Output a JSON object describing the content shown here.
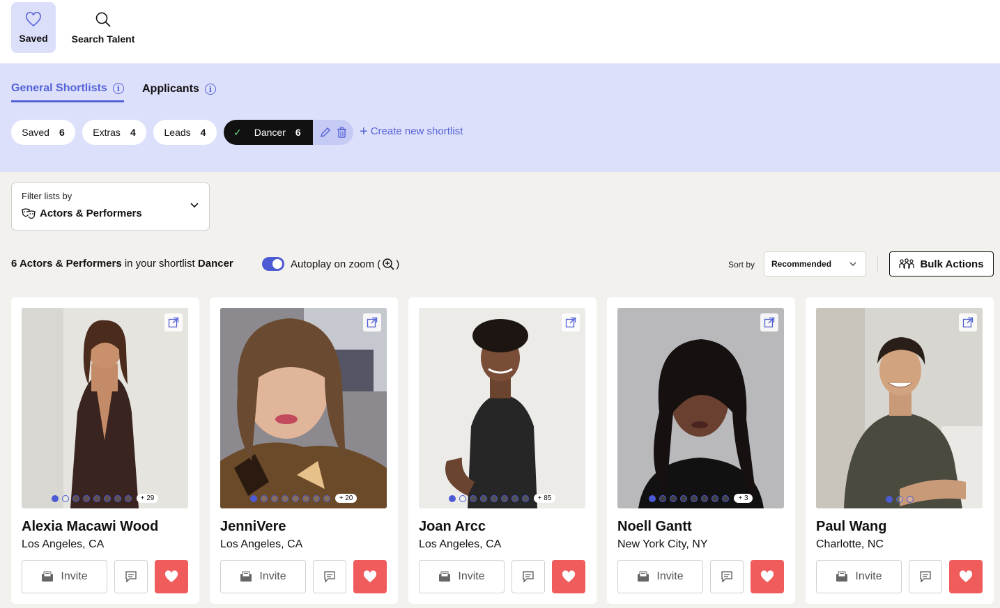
{
  "topnav": {
    "items": [
      {
        "label": "Saved",
        "icon": "heart-outline-icon",
        "active": true
      },
      {
        "label": "Search Talent",
        "icon": "search-icon",
        "active": false
      }
    ]
  },
  "tabs": [
    {
      "label": "General Shortlists",
      "active": true
    },
    {
      "label": "Applicants",
      "active": false
    }
  ],
  "shortlists": [
    {
      "label": "Saved",
      "count": "6"
    },
    {
      "label": "Extras",
      "count": "4"
    },
    {
      "label": "Leads",
      "count": "4"
    },
    {
      "label": "Dancer",
      "count": "6",
      "selected": true
    }
  ],
  "create_label": "Create new shortlist",
  "filter": {
    "label": "Filter lists by",
    "value": "Actors & Performers"
  },
  "summary": {
    "count_label": "6 Actors & Performers",
    "middle": "in your shortlist",
    "list_name": "Dancer",
    "autoplay_label": "Autoplay on zoom (",
    "autoplay_close": ")",
    "autoplay_on": true
  },
  "sort": {
    "label": "Sort by",
    "value": "Recommended"
  },
  "bulk_label": "Bulk Actions",
  "colors": {
    "accent": "#4c5bd4",
    "band": "#dde0fb",
    "heart": "#f05c5c"
  },
  "cards": [
    {
      "name": "Alexia Macawi Wood",
      "location": "Los Angeles, CA",
      "more": "+ 29",
      "dots": 8,
      "invite": "Invite"
    },
    {
      "name": "JenniVere",
      "location": "Los Angeles, CA",
      "more": "+ 20",
      "dots": 8,
      "invite": "Invite"
    },
    {
      "name": "Joan Arcc",
      "location": "Los Angeles, CA",
      "more": "+ 85",
      "dots": 8,
      "invite": "Invite"
    },
    {
      "name": "Noell Gantt",
      "location": "New York City, NY",
      "more": "+ 3",
      "dots": 8,
      "invite": "Invite"
    },
    {
      "name": "Paul Wang",
      "location": "Charlotte, NC",
      "more": "",
      "dots": 3,
      "invite": "Invite"
    }
  ]
}
